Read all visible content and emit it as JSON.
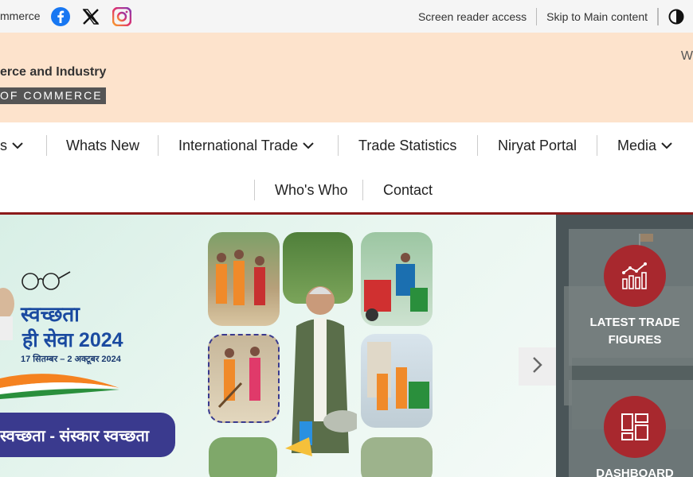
{
  "topbar": {
    "brand_text": "mmerce",
    "social_icons": [
      "facebook-icon",
      "x-icon",
      "instagram-icon"
    ],
    "links": [
      "Screen reader access",
      "Skip to Main content"
    ],
    "contrast_icon": "contrast-icon"
  },
  "header": {
    "ministry_partial": "erce and Industry",
    "department_partial": "OF COMMERCE",
    "right_partial": "W"
  },
  "nav": {
    "row1": [
      {
        "label": "s",
        "dropdown": true
      },
      {
        "label": "Whats New",
        "dropdown": false
      },
      {
        "label": "International Trade",
        "dropdown": true
      },
      {
        "label": "Trade Statistics",
        "dropdown": false
      },
      {
        "label": "Niryat Portal",
        "dropdown": false
      },
      {
        "label": "Media",
        "dropdown": true
      }
    ],
    "row2": [
      {
        "label": "Who's Who"
      },
      {
        "label": "Contact"
      }
    ]
  },
  "banner": {
    "title": "स्वच्छता",
    "subtitle": "ही सेवा 2024",
    "dates": "17 सितम्बर – 2 अक्टूबर 2024",
    "band_text": "स्वच्छता - संस्कार स्वच्छता",
    "next_icon": "chevron-right-icon"
  },
  "side_cards": [
    {
      "label_line1": "LATEST TRADE",
      "label_line2": "FIGURES",
      "icon": "bar-chart-icon"
    },
    {
      "label_line1": "DASHBOARD",
      "label_line2": "",
      "icon": "dashboard-icon"
    }
  ],
  "colors": {
    "header_bg": "#fde3cc",
    "accent_red": "#8b1a1a",
    "card_circle": "#a8282e",
    "banner_blue": "#1a4aa0"
  }
}
